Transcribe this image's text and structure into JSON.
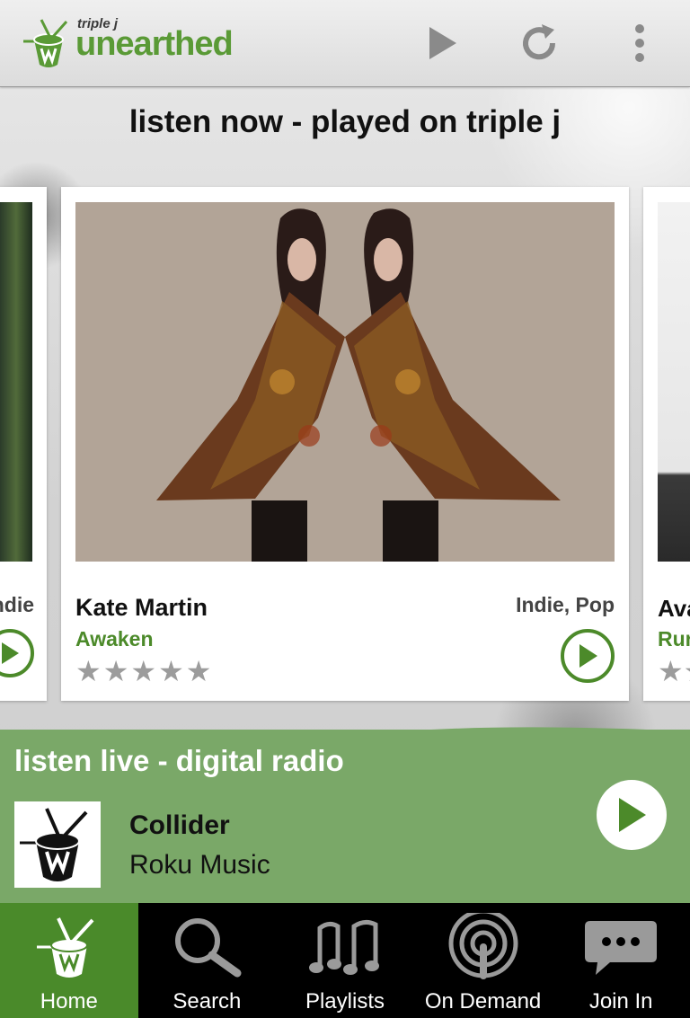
{
  "app": {
    "logo_small": "triple j",
    "logo_big": "unearthed"
  },
  "toolbar": {
    "play_icon": "play-icon",
    "refresh_icon": "refresh-icon",
    "menu_icon": "overflow-menu-icon"
  },
  "section": {
    "heading": "listen now - played on triple j"
  },
  "cards": {
    "left_peek": {
      "genre_partial": "ndie"
    },
    "main": {
      "artist": "Kate Martin",
      "track": "Awaken",
      "genre": "Indie, Pop",
      "rating": 0,
      "rating_max": 5
    },
    "right_peek": {
      "artist_partial": "Ava",
      "track_partial": "Rur"
    }
  },
  "live": {
    "title": "listen live - digital radio",
    "song": "Collider",
    "artist": "Roku Music"
  },
  "nav": {
    "items": [
      {
        "label": "Home",
        "icon": "home-drum-icon",
        "active": true
      },
      {
        "label": "Search",
        "icon": "search-icon",
        "active": false
      },
      {
        "label": "Playlists",
        "icon": "music-notes-icon",
        "active": false
      },
      {
        "label": "On Demand",
        "icon": "podcast-icon",
        "active": false
      },
      {
        "label": "Join In",
        "icon": "chat-bubble-icon",
        "active": false
      }
    ]
  },
  "colors": {
    "brand_green": "#4c8a2a",
    "live_bar": "#7aa868",
    "nav_active": "#4a8a2a"
  }
}
